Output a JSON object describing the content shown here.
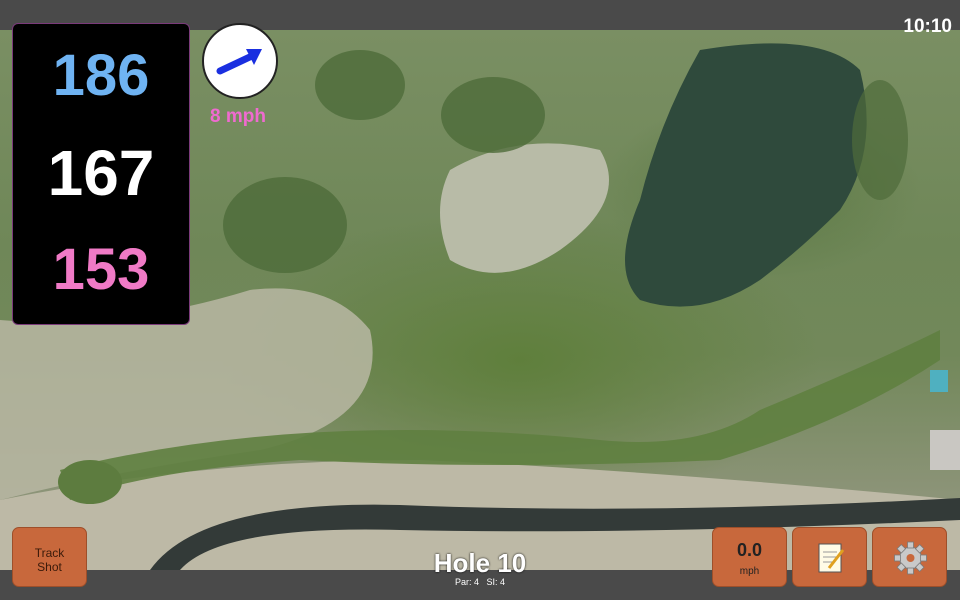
{
  "status": {
    "time": "10:10"
  },
  "distances": {
    "back": "186",
    "middle": "167",
    "front": "153"
  },
  "wind": {
    "speed_label": "8 mph",
    "direction_icon": "wind-arrow-icon"
  },
  "buttons": {
    "track_shot_line1": "Track",
    "track_shot_line2": "Shot",
    "speed_value": "0.0",
    "speed_unit": "mph",
    "notes_icon": "notepad-icon",
    "settings_icon": "gear-icon"
  },
  "hole": {
    "title": "Hole 10",
    "par": "Par: 4",
    "si": "SI: 4"
  },
  "colors": {
    "back": "#6fb3f2",
    "middle": "#ffffff",
    "front": "#f07ac6",
    "wind": "#f06ad0",
    "button": "#c8683c"
  }
}
